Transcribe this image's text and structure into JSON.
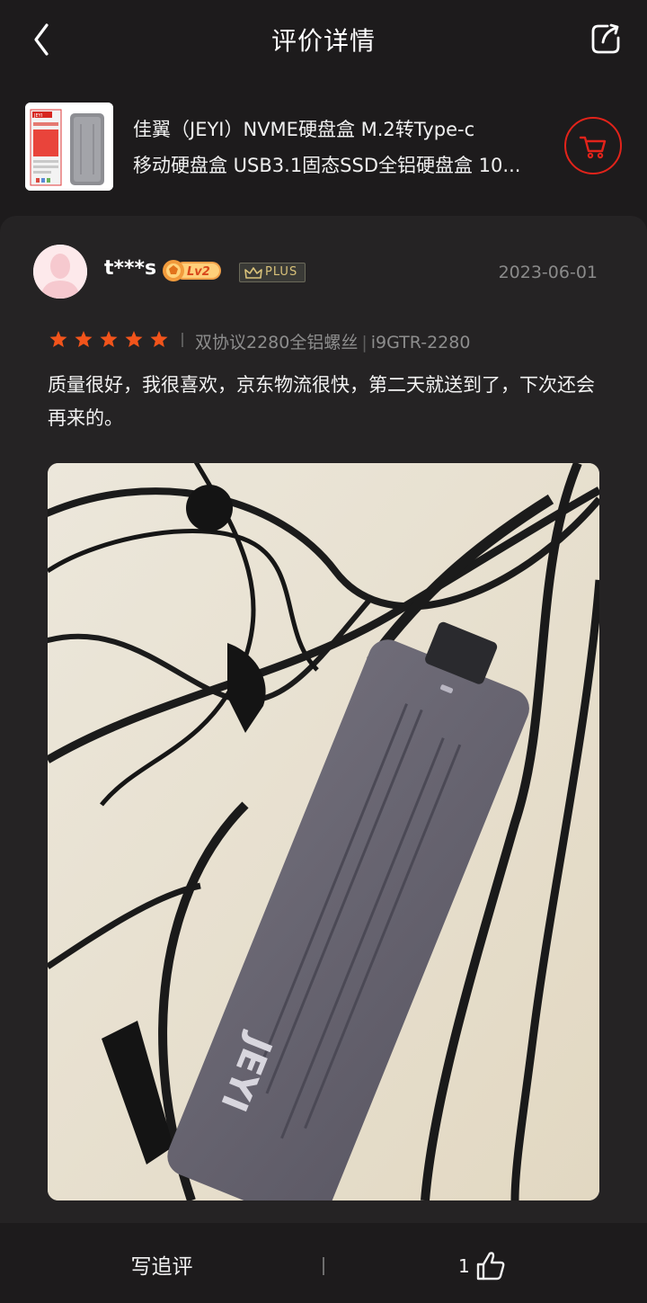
{
  "header": {
    "title": "评价详情",
    "back_icon": "chevron-left-icon",
    "share_icon": "share-icon"
  },
  "product": {
    "name_line1": "佳翼（JEYI）NVME硬盘盒 M.2转Type-c",
    "name_line2": "移动硬盘盒 USB3.1固态SSD全铝硬盘盒 10...",
    "thumb_logo": "JEYI",
    "cart_icon": "cart-icon",
    "accent_color": "#e2231a"
  },
  "review": {
    "username": "t***s",
    "level_badge": "Lv2",
    "plus_badge": "PLUS",
    "date": "2023-06-01",
    "rating": 5,
    "star_color": "#f2541b",
    "spec_variant": "双协议2280全铝螺丝",
    "spec_model": "i9GTR-2280",
    "spec_divider": "|",
    "text": "质量很好，我很喜欢，京东物流很快，第二天就送到了，下次还会再来的。",
    "photo_brand": "JEYI"
  },
  "bottom_bar": {
    "write_followup": "写追评",
    "like_count": "1",
    "like_icon": "thumbs-up-icon"
  }
}
